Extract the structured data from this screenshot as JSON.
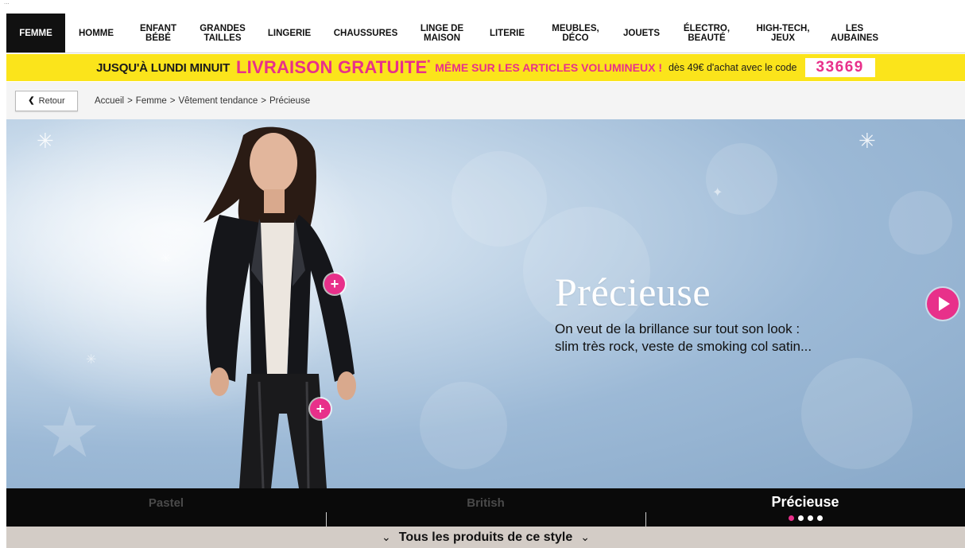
{
  "top_strip": {
    "dots": "..."
  },
  "nav": {
    "items": [
      {
        "label": "FEMME",
        "active": true
      },
      {
        "label": "HOMME"
      },
      {
        "label": "ENFANT\nBÉBÉ"
      },
      {
        "label": "GRANDES\nTAILLES"
      },
      {
        "label": "LINGERIE"
      },
      {
        "label": "CHAUSSURES"
      },
      {
        "label": "LINGE DE\nMAISON"
      },
      {
        "label": "LITERIE"
      },
      {
        "label": "MEUBLES,\nDÉCO"
      },
      {
        "label": "JOUETS"
      },
      {
        "label": "ÉLECTRO,\nBEAUTÉ"
      },
      {
        "label": "HIGH-TECH,\nJEUX"
      },
      {
        "label": "LES\nAUBAINES"
      }
    ]
  },
  "promo": {
    "part1": "JUSQU'À LUNDI MINUIT",
    "part2": "LIVRAISON GRATUITE",
    "asterisk": "*",
    "part3": "MÊME SUR LES ARTICLES VOLUMINEUX !",
    "part4": "dès 49€ d'achat avec le code",
    "code": "33669"
  },
  "breadcrumb": {
    "back_label": "Retour",
    "items": [
      "Accueil",
      "Femme",
      "Vêtement tendance",
      "Précieuse"
    ],
    "sep": ">"
  },
  "hero": {
    "title": "Précieuse",
    "description_line1": "On veut de la brillance sur tout son look :",
    "description_line2": "slim très rock, veste de smoking col satin...",
    "hotspot_symbol": "+"
  },
  "tabs": [
    {
      "label": "Pastel",
      "active": false
    },
    {
      "label": "British",
      "active": false
    },
    {
      "label": "Précieuse",
      "active": true
    }
  ],
  "pagination": {
    "total": 4,
    "current": 1
  },
  "all_products": {
    "label": "Tous les produits de ce style"
  },
  "colors": {
    "accent": "#e8308a",
    "promo_bg": "#fbe41b",
    "nav_active": "#111111"
  }
}
